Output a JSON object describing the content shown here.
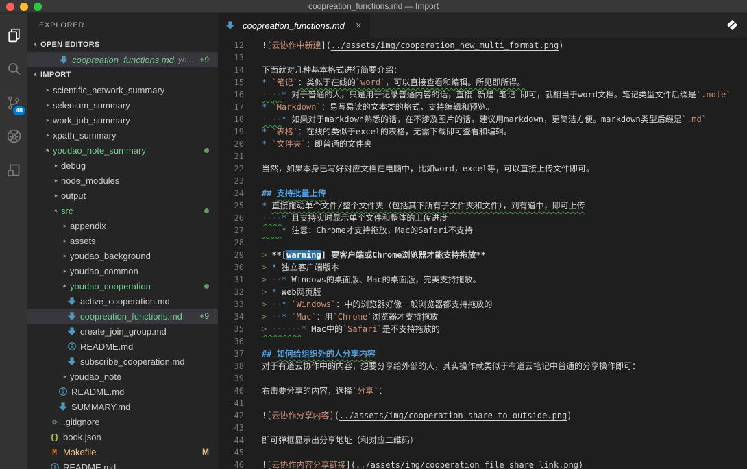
{
  "window": {
    "title": "coopreation_functions.md — Import"
  },
  "activity_bar": {
    "items": [
      {
        "id": "explorer",
        "active": true
      },
      {
        "id": "search",
        "active": false
      },
      {
        "id": "source-control",
        "active": false,
        "badge": "48"
      },
      {
        "id": "debug",
        "active": false
      },
      {
        "id": "extensions",
        "active": false
      }
    ]
  },
  "sidebar": {
    "title": "EXPLORER",
    "open_editors": {
      "header": "OPEN EDITORS",
      "items": [
        {
          "name": "coopreation_functions.md",
          "hint": "yo...",
          "badge": "+9",
          "icon": "markdown",
          "color": "green",
          "selected": true
        }
      ]
    },
    "folder_section": {
      "header": "IMPORT"
    },
    "tree": [
      {
        "label": "scientific_network_summary",
        "type": "folder",
        "expanded": false,
        "indent": 23
      },
      {
        "label": "selenium_summary",
        "type": "folder",
        "expanded": false,
        "indent": 23
      },
      {
        "label": "work_job_summary",
        "type": "folder",
        "expanded": false,
        "indent": 23
      },
      {
        "label": "xpath_summary",
        "type": "folder",
        "expanded": false,
        "indent": 23
      },
      {
        "label": "youdao_note_summary",
        "type": "folder",
        "expanded": true,
        "indent": 23,
        "color": "green",
        "dot": true
      },
      {
        "label": "debug",
        "type": "folder",
        "expanded": false,
        "indent": 35
      },
      {
        "label": "node_modules",
        "type": "folder",
        "expanded": false,
        "indent": 35
      },
      {
        "label": "output",
        "type": "folder",
        "expanded": false,
        "indent": 35
      },
      {
        "label": "src",
        "type": "folder",
        "expanded": true,
        "indent": 35,
        "color": "green",
        "dot": true
      },
      {
        "label": "appendix",
        "type": "folder",
        "expanded": false,
        "indent": 48
      },
      {
        "label": "assets",
        "type": "folder",
        "expanded": false,
        "indent": 48
      },
      {
        "label": "youdao_background",
        "type": "folder",
        "expanded": false,
        "indent": 48
      },
      {
        "label": "youdao_common",
        "type": "folder",
        "expanded": false,
        "indent": 48
      },
      {
        "label": "youdao_cooperation",
        "type": "folder",
        "expanded": true,
        "indent": 48,
        "color": "green",
        "dot": true
      },
      {
        "label": "active_cooperation.md",
        "type": "file",
        "icon": "markdown",
        "indent": 57
      },
      {
        "label": "coopreation_functions.md",
        "type": "file",
        "icon": "markdown",
        "indent": 57,
        "color": "green",
        "badge": "+9",
        "selected": true
      },
      {
        "label": "create_join_group.md",
        "type": "file",
        "icon": "markdown",
        "indent": 57
      },
      {
        "label": "README.md",
        "type": "file",
        "icon": "info",
        "indent": 57
      },
      {
        "label": "subscribe_cooperation.md",
        "type": "file",
        "icon": "markdown",
        "indent": 57
      },
      {
        "label": "youdao_note",
        "type": "folder",
        "expanded": false,
        "indent": 48
      },
      {
        "label": "README.md",
        "type": "file",
        "icon": "info",
        "indent": 44
      },
      {
        "label": "SUMMARY.md",
        "type": "file",
        "icon": "markdown",
        "indent": 44
      },
      {
        "label": ".gitignore",
        "type": "file",
        "icon": "git",
        "indent": 32
      },
      {
        "label": "book.json",
        "type": "file",
        "icon": "json",
        "indent": 32
      },
      {
        "label": "Makefile",
        "type": "file",
        "icon": "makefile",
        "indent": 32,
        "color": "tan",
        "badge_m": "M"
      },
      {
        "label": "README.md",
        "type": "file",
        "icon": "info",
        "indent": 32
      }
    ]
  },
  "editor": {
    "tab": {
      "name": "coopreation_functions.md",
      "icon": "markdown",
      "close": "×"
    },
    "lines": [
      {
        "n": 12,
        "spans": [
          [
            "w",
            "!["
          ],
          [
            "o",
            "云协作中新建"
          ],
          [
            "w",
            "]("
          ],
          [
            "u",
            "../assets/img/cooperation_new_multi_format.png"
          ],
          [
            "w",
            ")"
          ]
        ]
      },
      {
        "n": 13,
        "spans": []
      },
      {
        "n": 14,
        "spans": [
          [
            "w",
            "下面就对几种基本格式进行简要介绍："
          ]
        ]
      },
      {
        "n": 15,
        "spans": [
          [
            "b",
            "* "
          ],
          [
            "o",
            "`笔记`"
          ],
          [
            "w sq",
            "：类似于在线的"
          ],
          [
            "o sq",
            "`word`"
          ],
          [
            "w sq",
            "，可以直接查看和编辑。所见即所得。"
          ]
        ]
      },
      {
        "n": 16,
        "spans": [
          [
            "d sq",
            "····"
          ],
          [
            "b",
            "* "
          ],
          [
            "w",
            "对于普通的人，只是用于记录普通内容的话，直接 新建 笔记 即可，就相当于word文档。笔记类型文件后缀是"
          ],
          [
            "o",
            "`.note`"
          ]
        ]
      },
      {
        "n": 17,
        "spans": [
          [
            "b",
            "* "
          ],
          [
            "o",
            "`Markdown`"
          ],
          [
            "w",
            "：易写易读的文本类的格式，支持编辑和预览。"
          ]
        ]
      },
      {
        "n": 18,
        "spans": [
          [
            "d sq",
            "····"
          ],
          [
            "b",
            "* "
          ],
          [
            "w",
            "如果对于markdown熟悉的话，在不涉及图片的话，建议用markdown，更简洁方便。markdown类型后缀是"
          ],
          [
            "o",
            "`.md`"
          ]
        ]
      },
      {
        "n": 19,
        "spans": [
          [
            "b",
            "* "
          ],
          [
            "o",
            "`表格`"
          ],
          [
            "w",
            "：在线的类似于excel的表格，无需下载即可查看和编辑。"
          ]
        ]
      },
      {
        "n": 20,
        "spans": [
          [
            "b",
            "* "
          ],
          [
            "o",
            "`文件夹`"
          ],
          [
            "w",
            "：即普通的文件夹"
          ]
        ]
      },
      {
        "n": 21,
        "spans": []
      },
      {
        "n": 22,
        "spans": [
          [
            "w",
            "当然，如果本身已写好对应文档在电脑中，比如word，excel等，可以直接上传文件即可。"
          ]
        ]
      },
      {
        "n": 23,
        "spans": []
      },
      {
        "n": 24,
        "spans": [
          [
            "hd",
            "## "
          ],
          [
            "hd sq",
            "支持批量上传"
          ]
        ]
      },
      {
        "n": 25,
        "spans": [
          [
            "b",
            "* "
          ],
          [
            "w sq",
            "直接拖动单个文件/整个文件夹（包括其下所有子文件夹和文件），到有道中，即可上传"
          ]
        ]
      },
      {
        "n": 26,
        "spans": [
          [
            "d sq",
            "····"
          ],
          [
            "b",
            "* "
          ],
          [
            "w",
            "且支持实时显示单个文件和整体的上传进度"
          ]
        ]
      },
      {
        "n": 27,
        "spans": [
          [
            "d sq",
            "····"
          ],
          [
            "b",
            "* "
          ],
          [
            "w",
            "注意：Chrome才支持拖放，Mac的Safari不支持"
          ]
        ]
      },
      {
        "n": 28,
        "spans": []
      },
      {
        "n": 29,
        "spans": [
          [
            "g",
            "> "
          ],
          [
            "bd",
            "**["
          ],
          [
            "hl bd",
            "warning"
          ],
          [
            "bd",
            "] 要客户端或Chrome浏览器才能支持拖放**"
          ]
        ]
      },
      {
        "n": 30,
        "spans": [
          [
            "g",
            "> "
          ],
          [
            "b",
            "* "
          ],
          [
            "w",
            "独立客户端版本"
          ]
        ]
      },
      {
        "n": 31,
        "spans": [
          [
            "g",
            "> "
          ],
          [
            "d",
            "··"
          ],
          [
            "b",
            "* "
          ],
          [
            "w",
            "Windows的桌面版、Mac的桌面版，完美支持拖放。"
          ]
        ]
      },
      {
        "n": 32,
        "spans": [
          [
            "g",
            "> "
          ],
          [
            "b",
            "* "
          ],
          [
            "w",
            "Web网页版"
          ]
        ]
      },
      {
        "n": 33,
        "spans": [
          [
            "g",
            "> "
          ],
          [
            "d",
            "··"
          ],
          [
            "b",
            "* "
          ],
          [
            "o",
            "`Windows`"
          ],
          [
            "w",
            "：中的浏览器好像一般浏览器都支持拖放的"
          ]
        ]
      },
      {
        "n": 34,
        "spans": [
          [
            "g",
            "> "
          ],
          [
            "d",
            "··"
          ],
          [
            "b",
            "* "
          ],
          [
            "o",
            "`Mac`"
          ],
          [
            "w",
            "：用"
          ],
          [
            "o",
            "`Chrome`"
          ],
          [
            "w",
            "浏览器才支持拖放"
          ]
        ]
      },
      {
        "n": 35,
        "spans": [
          [
            "g sq",
            "> "
          ],
          [
            "d sq",
            "······"
          ],
          [
            "b",
            "* "
          ],
          [
            "w",
            "Mac中的"
          ],
          [
            "o",
            "`Safari`"
          ],
          [
            "w",
            "是不支持拖放的"
          ]
        ]
      },
      {
        "n": 36,
        "spans": []
      },
      {
        "n": 37,
        "spans": [
          [
            "hd",
            "## "
          ],
          [
            "hd sq",
            "如何给组织外的人分享内容"
          ]
        ]
      },
      {
        "n": 38,
        "spans": [
          [
            "w",
            "对于有道云协作中的内容，想要分享给外部的人，其实操作就类似于有道云笔记中普通的分享操作即可："
          ]
        ]
      },
      {
        "n": 39,
        "spans": []
      },
      {
        "n": 40,
        "spans": [
          [
            "w",
            "右击要分享的内容，选择"
          ],
          [
            "o",
            "`分享`"
          ],
          [
            "w",
            "："
          ]
        ]
      },
      {
        "n": 41,
        "spans": []
      },
      {
        "n": 42,
        "spans": [
          [
            "w",
            "!["
          ],
          [
            "o",
            "云协作分享内容"
          ],
          [
            "w",
            "]("
          ],
          [
            "u",
            "../assets/img/cooperation_share_to_outside.png"
          ],
          [
            "w",
            ")"
          ]
        ]
      },
      {
        "n": 43,
        "spans": []
      },
      {
        "n": 44,
        "spans": [
          [
            "w",
            "即可弹框显示出分享地址（和对应二维码）"
          ]
        ]
      },
      {
        "n": 45,
        "spans": []
      },
      {
        "n": 46,
        "spans": [
          [
            "w",
            "!["
          ],
          [
            "o",
            "云协作内容分享链接"
          ],
          [
            "w",
            "]("
          ],
          [
            "u",
            "../assets/img/cooperation_file_share_link.png"
          ],
          [
            "w",
            ")"
          ]
        ]
      }
    ]
  },
  "colors": {
    "titlebar_bg": "#383838",
    "activitybar_bg": "#333333",
    "sidebar_bg": "#252526",
    "editor_bg": "#1e1e1e",
    "accent_badge": "#007acc",
    "untracked_green": "#73c991",
    "modified_tan": "#e2c08d",
    "code_orange": "#ce9178",
    "heading_blue": "#569cd6",
    "quote_green": "#6a9955",
    "squiggle_green": "#3f9e44",
    "highlight_blue": "#35719f",
    "seti_icon_blue": "#519aba",
    "makefile_orange": "#e37933",
    "json_yellow": "#cbcb41"
  }
}
